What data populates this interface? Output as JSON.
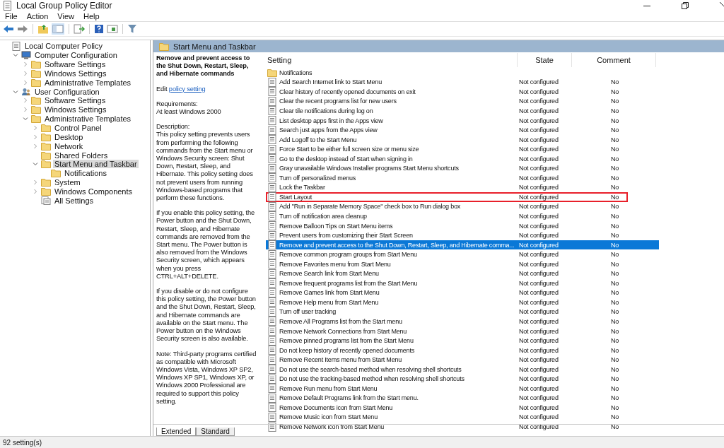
{
  "window": {
    "title": "Local Group Policy Editor"
  },
  "menu": [
    "File",
    "Action",
    "View",
    "Help"
  ],
  "tree": [
    {
      "label": "Local Computer Policy",
      "kind": "policy",
      "selected": false,
      "children": [
        {
          "label": "Computer Configuration",
          "kind": "computer",
          "expanded": true,
          "selected": false,
          "children": [
            {
              "label": "Software Settings",
              "kind": "folder",
              "expanded": false,
              "selected": false
            },
            {
              "label": "Windows Settings",
              "kind": "folder",
              "expanded": false,
              "selected": false
            },
            {
              "label": "Administrative Templates",
              "kind": "folder",
              "expanded": false,
              "selected": false
            }
          ]
        },
        {
          "label": "User Configuration",
          "kind": "user",
          "expanded": true,
          "selected": false,
          "children": [
            {
              "label": "Software Settings",
              "kind": "folder",
              "expanded": false,
              "selected": false
            },
            {
              "label": "Windows Settings",
              "kind": "folder",
              "expanded": false,
              "selected": false
            },
            {
              "label": "Administrative Templates",
              "kind": "folder",
              "expanded": true,
              "selected": false,
              "children": [
                {
                  "label": "Control Panel",
                  "kind": "folder",
                  "expanded": false,
                  "selected": false
                },
                {
                  "label": "Desktop",
                  "kind": "folder",
                  "expanded": false,
                  "selected": false
                },
                {
                  "label": "Network",
                  "kind": "folder",
                  "expanded": false,
                  "selected": false
                },
                {
                  "label": "Shared Folders",
                  "kind": "folder",
                  "selected": false
                },
                {
                  "label": "Start Menu and Taskbar",
                  "kind": "folder",
                  "expanded": true,
                  "selected": true,
                  "children": [
                    {
                      "label": "Notifications",
                      "kind": "folder",
                      "selected": false
                    }
                  ]
                },
                {
                  "label": "System",
                  "kind": "folder",
                  "expanded": false,
                  "selected": false
                },
                {
                  "label": "Windows Components",
                  "kind": "folder",
                  "expanded": false,
                  "selected": false
                },
                {
                  "label": "All Settings",
                  "kind": "settings",
                  "selected": false
                }
              ]
            }
          ]
        }
      ]
    }
  ],
  "header": {
    "title": "Start Menu and Taskbar"
  },
  "description": {
    "title": "Remove and prevent access to the Shut Down, Restart, Sleep, and Hibernate commands",
    "edit_prefix": "Edit",
    "edit_link": "policy setting",
    "requirements_label": "Requirements:",
    "requirements": "At least Windows 2000",
    "description_label": "Description:",
    "paragraphs": [
      "This policy setting prevents users from performing the following commands from the Start menu or Windows Security screen: Shut Down, Restart, Sleep, and Hibernate. This policy setting does not prevent users from running Windows-based programs that perform these functions.",
      "If you enable this policy setting, the Power button and the Shut Down, Restart, Sleep, and Hibernate commands are removed from the Start menu. The Power button is also removed from the Windows Security screen, which appears when you press CTRL+ALT+DELETE.",
      "If you disable or do not configure this policy setting, the Power button and the Shut Down, Restart, Sleep, and Hibernate commands are available on the Start menu. The Power button on the Windows Security screen is also available.",
      "Note: Third-party programs certified as compatible with Microsoft Windows Vista, Windows XP SP2, Windows XP SP1, Windows XP, or Windows 2000 Professional are required to support this policy setting."
    ]
  },
  "table": {
    "columns": [
      "Setting",
      "State",
      "Comment"
    ],
    "rows": [
      {
        "kind": "folder",
        "setting": "Notifications",
        "selected": false,
        "highlighted": false
      },
      {
        "kind": "policy",
        "setting": "Add Search Internet link to Start Menu",
        "state": "Not configured",
        "comment": "No",
        "selected": false,
        "highlighted": false
      },
      {
        "kind": "policy",
        "setting": "Clear history of recently opened documents on exit",
        "state": "Not configured",
        "comment": "No",
        "selected": false,
        "highlighted": false
      },
      {
        "kind": "policy",
        "setting": "Clear the recent programs list for new users",
        "state": "Not configured",
        "comment": "No",
        "selected": false,
        "highlighted": false
      },
      {
        "kind": "policy",
        "setting": "Clear tile notifications during log on",
        "state": "Not configured",
        "comment": "No",
        "selected": false,
        "highlighted": false
      },
      {
        "kind": "policy",
        "setting": "List desktop apps first in the Apps view",
        "state": "Not configured",
        "comment": "No",
        "selected": false,
        "highlighted": false
      },
      {
        "kind": "policy",
        "setting": "Search just apps from the Apps view",
        "state": "Not configured",
        "comment": "No",
        "selected": false,
        "highlighted": false
      },
      {
        "kind": "policy",
        "setting": "Add Logoff to the Start Menu",
        "state": "Not configured",
        "comment": "No",
        "selected": false,
        "highlighted": false
      },
      {
        "kind": "policy",
        "setting": "Force Start to be either full screen size or menu size",
        "state": "Not configured",
        "comment": "No",
        "selected": false,
        "highlighted": false
      },
      {
        "kind": "policy",
        "setting": "Go to the desktop instead of Start when signing in",
        "state": "Not configured",
        "comment": "No",
        "selected": false,
        "highlighted": false
      },
      {
        "kind": "policy",
        "setting": "Gray unavailable Windows Installer programs Start Menu shortcuts",
        "state": "Not configured",
        "comment": "No",
        "selected": false,
        "highlighted": false
      },
      {
        "kind": "policy",
        "setting": "Turn off personalized menus",
        "state": "Not configured",
        "comment": "No",
        "selected": false,
        "highlighted": false
      },
      {
        "kind": "policy",
        "setting": "Lock the Taskbar",
        "state": "Not configured",
        "comment": "No",
        "selected": false,
        "highlighted": false
      },
      {
        "kind": "policy",
        "setting": "Start Layout",
        "state": "Not configured",
        "comment": "No",
        "selected": false,
        "highlighted": true
      },
      {
        "kind": "policy",
        "setting": "Add \"Run in Separate Memory Space\" check box to Run dialog box",
        "state": "Not configured",
        "comment": "No",
        "selected": false,
        "highlighted": false
      },
      {
        "kind": "policy",
        "setting": "Turn off notification area cleanup",
        "state": "Not configured",
        "comment": "No",
        "selected": false,
        "highlighted": false
      },
      {
        "kind": "policy",
        "setting": "Remove Balloon Tips on Start Menu items",
        "state": "Not configured",
        "comment": "No",
        "selected": false,
        "highlighted": false
      },
      {
        "kind": "policy",
        "setting": "Prevent users from customizing their Start Screen",
        "state": "Not configured",
        "comment": "No",
        "selected": false,
        "highlighted": false
      },
      {
        "kind": "policy",
        "setting": "Remove and prevent access to the Shut Down, Restart, Sleep, and Hibernate comma...",
        "state": "Not configured",
        "comment": "No",
        "selected": true,
        "highlighted": false
      },
      {
        "kind": "policy",
        "setting": "Remove common program groups from Start Menu",
        "state": "Not configured",
        "comment": "No",
        "selected": false,
        "highlighted": false
      },
      {
        "kind": "policy",
        "setting": "Remove Favorites menu from Start Menu",
        "state": "Not configured",
        "comment": "No",
        "selected": false,
        "highlighted": false
      },
      {
        "kind": "policy",
        "setting": "Remove Search link from Start Menu",
        "state": "Not configured",
        "comment": "No",
        "selected": false,
        "highlighted": false
      },
      {
        "kind": "policy",
        "setting": "Remove frequent programs list from the Start Menu",
        "state": "Not configured",
        "comment": "No",
        "selected": false,
        "highlighted": false
      },
      {
        "kind": "policy",
        "setting": "Remove Games link from Start Menu",
        "state": "Not configured",
        "comment": "No",
        "selected": false,
        "highlighted": false
      },
      {
        "kind": "policy",
        "setting": "Remove Help menu from Start Menu",
        "state": "Not configured",
        "comment": "No",
        "selected": false,
        "highlighted": false
      },
      {
        "kind": "policy",
        "setting": "Turn off user tracking",
        "state": "Not configured",
        "comment": "No",
        "selected": false,
        "highlighted": false
      },
      {
        "kind": "policy",
        "setting": "Remove All Programs list from the Start menu",
        "state": "Not configured",
        "comment": "No",
        "selected": false,
        "highlighted": false
      },
      {
        "kind": "policy",
        "setting": "Remove Network Connections from Start Menu",
        "state": "Not configured",
        "comment": "No",
        "selected": false,
        "highlighted": false
      },
      {
        "kind": "policy",
        "setting": "Remove pinned programs list from the Start Menu",
        "state": "Not configured",
        "comment": "No",
        "selected": false,
        "highlighted": false
      },
      {
        "kind": "policy",
        "setting": "Do not keep history of recently opened documents",
        "state": "Not configured",
        "comment": "No",
        "selected": false,
        "highlighted": false
      },
      {
        "kind": "policy",
        "setting": "Remove Recent Items menu from Start Menu",
        "state": "Not configured",
        "comment": "No",
        "selected": false,
        "highlighted": false
      },
      {
        "kind": "policy",
        "setting": "Do not use the search-based method when resolving shell shortcuts",
        "state": "Not configured",
        "comment": "No",
        "selected": false,
        "highlighted": false
      },
      {
        "kind": "policy",
        "setting": "Do not use the tracking-based method when resolving shell shortcuts",
        "state": "Not configured",
        "comment": "No",
        "selected": false,
        "highlighted": false
      },
      {
        "kind": "policy",
        "setting": "Remove Run menu from Start Menu",
        "state": "Not configured",
        "comment": "No",
        "selected": false,
        "highlighted": false
      },
      {
        "kind": "policy",
        "setting": "Remove Default Programs link from the Start menu.",
        "state": "Not configured",
        "comment": "No",
        "selected": false,
        "highlighted": false
      },
      {
        "kind": "policy",
        "setting": "Remove Documents icon from Start Menu",
        "state": "Not configured",
        "comment": "No",
        "selected": false,
        "highlighted": false
      },
      {
        "kind": "policy",
        "setting": "Remove Music icon from Start Menu",
        "state": "Not configured",
        "comment": "No",
        "selected": false,
        "highlighted": false
      },
      {
        "kind": "policy",
        "setting": "Remove Network icon from Start Menu",
        "state": "Not configured",
        "comment": "No",
        "selected": false,
        "highlighted": false
      }
    ]
  },
  "tabs": [
    {
      "label": "Extended",
      "selected": true
    },
    {
      "label": "Standard",
      "selected": false
    }
  ],
  "status_bar": "92 setting(s)"
}
